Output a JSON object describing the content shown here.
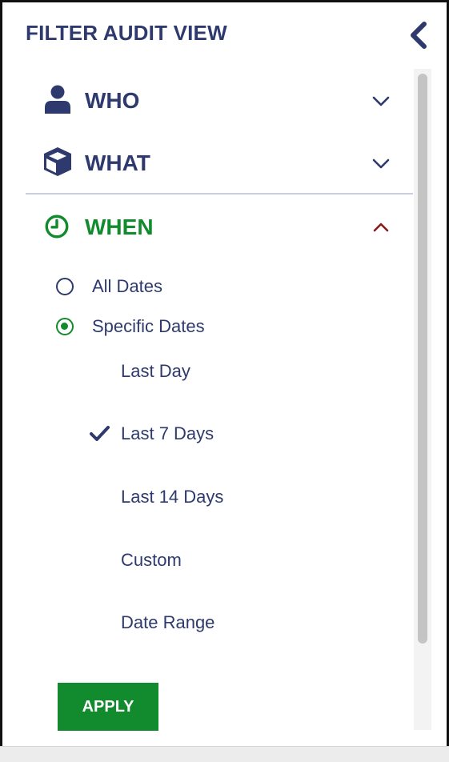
{
  "header": {
    "title": "FILTER AUDIT VIEW",
    "collapse_icon": "chevron-left-icon"
  },
  "sections": {
    "who": {
      "label": "WHO",
      "icon": "person-icon",
      "expanded": false
    },
    "what": {
      "label": "WHAT",
      "icon": "cube-icon",
      "expanded": false
    },
    "when": {
      "label": "WHEN",
      "icon": "clock-icon",
      "expanded": true
    }
  },
  "when_panel": {
    "radios": [
      {
        "label": "All Dates",
        "selected": false
      },
      {
        "label": "Specific Dates",
        "selected": true
      }
    ],
    "options": [
      {
        "label": "Last Day",
        "checked": false
      },
      {
        "label": "Last 7 Days",
        "checked": true
      },
      {
        "label": "Last 14 Days",
        "checked": false
      },
      {
        "label": "Custom",
        "checked": false
      },
      {
        "label": "Date Range",
        "checked": false
      }
    ]
  },
  "apply_label": "APPLY",
  "colors": {
    "navy": "#2e3a6e",
    "green": "#128a2e",
    "dark_red": "#8b1a1a"
  }
}
